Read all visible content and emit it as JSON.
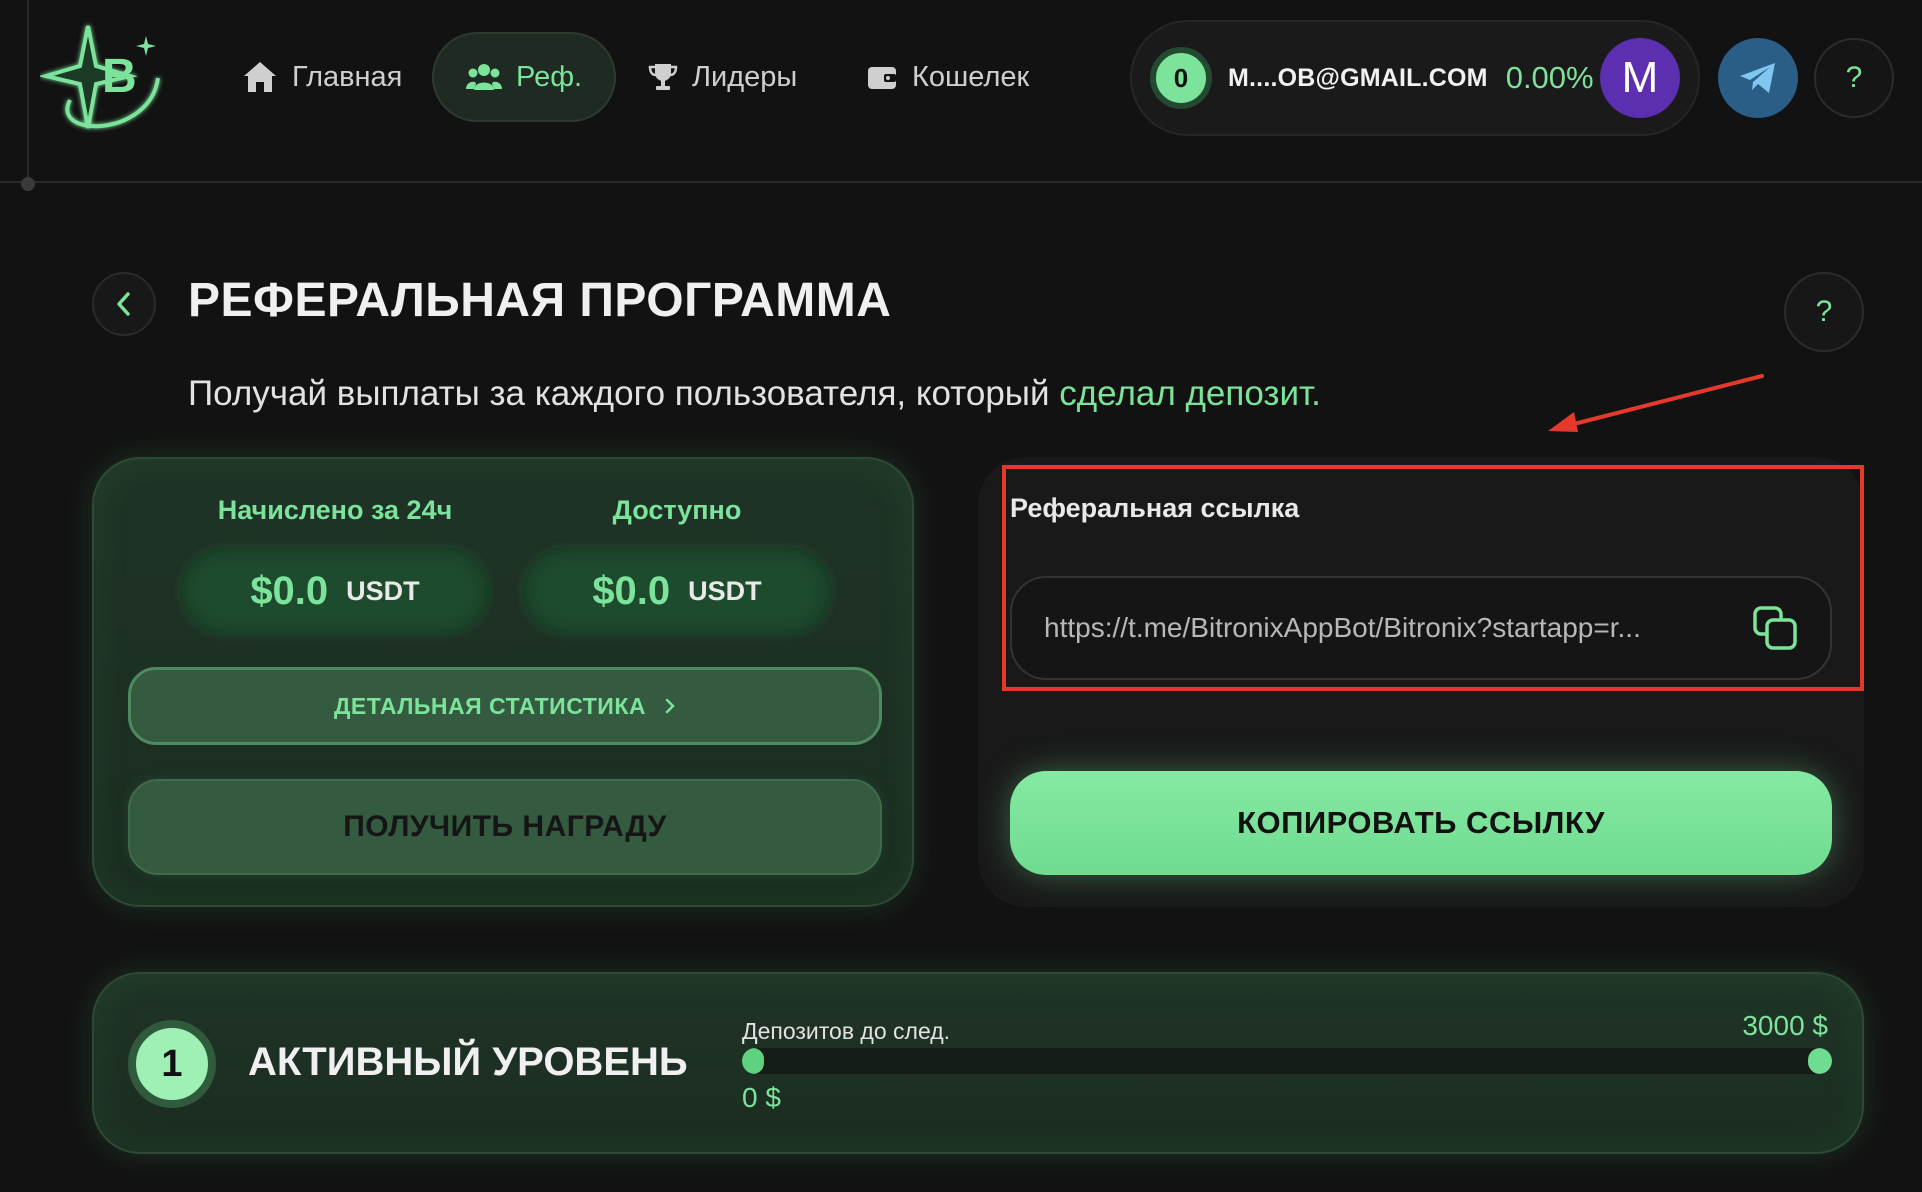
{
  "nav": {
    "home": "Главная",
    "referral": "Реф.",
    "leaders": "Лидеры",
    "wallet": "Кошелек"
  },
  "account": {
    "level": "0",
    "email": "M....OB@GMAIL.COM",
    "percent": "0.00%",
    "avatar_letter": "M"
  },
  "help_label": "?",
  "page": {
    "title": "РЕФЕРАЛЬНАЯ ПРОГРАММА",
    "subtitle_main": "Получай выплаты за каждого пользователя, который ",
    "subtitle_highlight": "сделал депозит."
  },
  "stats": {
    "accrued_label": "Начислено за 24ч",
    "accrued_amount": "$0.0",
    "accrued_currency": "USDT",
    "available_label": "Доступно",
    "available_amount": "$0.0",
    "available_currency": "USDT",
    "details_label": "ДЕТАЛЬНАЯ СТАТИСТИКА",
    "claim_label": "ПОЛУЧИТЬ НАГРАДУ"
  },
  "referral": {
    "label": "Реферальная ссылка",
    "link": "https://t.me/BitronixAppBot/Bitronix?startapp=r...",
    "copy_label": "КОПИРОВАТЬ ССЫЛКУ"
  },
  "level": {
    "number": "1",
    "title": "АКТИВНЫЙ УРОВЕНЬ",
    "progress_label": "Депозитов до след.",
    "target": "3000 $",
    "current": "0 $",
    "progress_fraction": 0.02
  },
  "colors": {
    "accent": "#7be39a",
    "annotation": "#e53a2b",
    "avatar": "#5b2fb0",
    "telegram": "#2a5e86"
  }
}
